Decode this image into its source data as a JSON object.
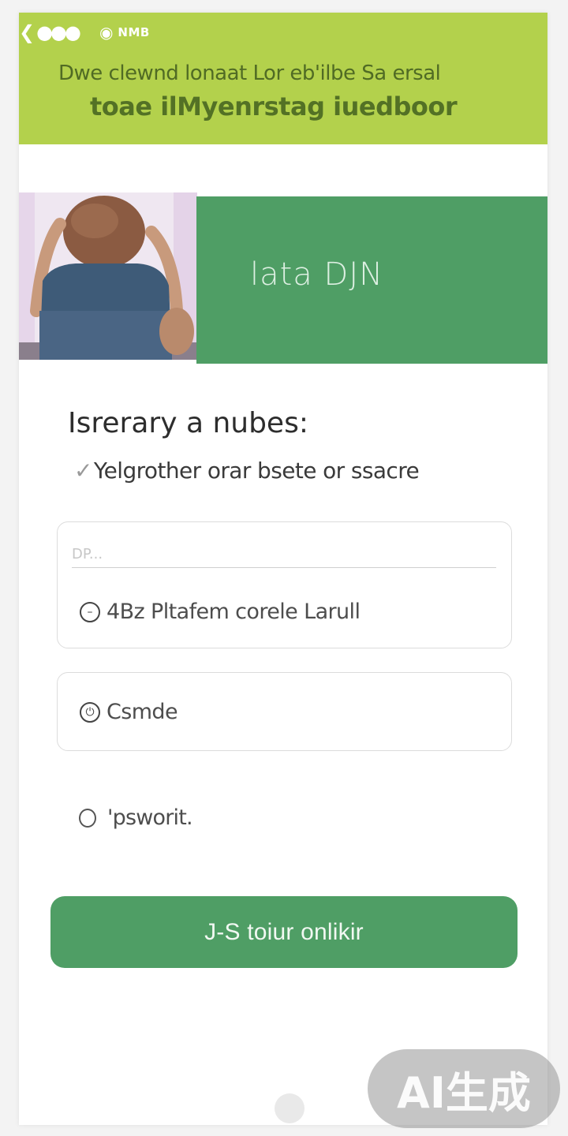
{
  "status_bar": {
    "text": "NMB",
    "back_icon": "back-arrow-icon",
    "wifi_icon": "wifi-icon"
  },
  "header": {
    "line1": "Dwe clewnd lonaat Lor eb'ilbe Sa ersal",
    "line2": "toae ilMyenrstag iuedboor",
    "background": "#b3d14c"
  },
  "hero": {
    "banner_text": "lata DJN",
    "banner_color": "#4f9e65"
  },
  "form": {
    "title": "Isrerary a nubes:",
    "subtitle": "Yelgrother orar bsete or ssacre",
    "card1": {
      "placeholder": "DP...",
      "field_label": "4Bz Pltafem corele Larull",
      "icon": "minus-circle-icon"
    },
    "card2": {
      "field_label": "Csmde",
      "icon": "power-icon"
    },
    "password_label": "'psworit.",
    "submit_label": "J-S toiur onlikir"
  },
  "watermark": {
    "text": "AI生成"
  }
}
